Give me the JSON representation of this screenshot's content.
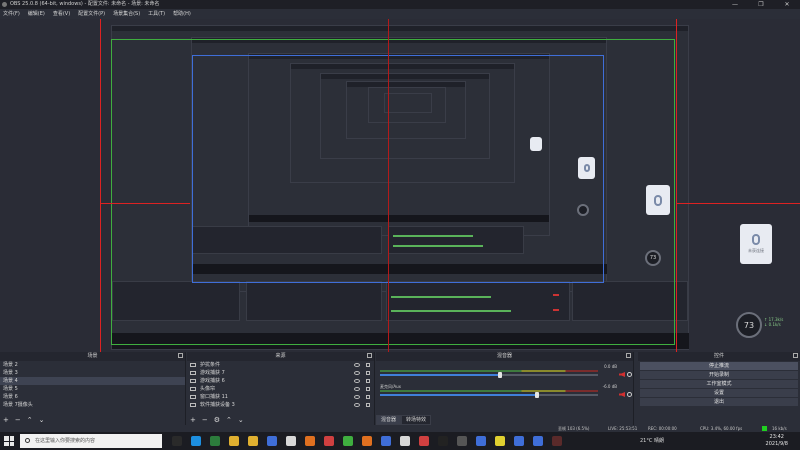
{
  "window": {
    "title": "OBS 25.0.8 (64-bit, windows) - 配置文件: 未命名 - 场景: 未命名",
    "controls": [
      "—",
      "❐",
      "✕"
    ]
  },
  "menu": [
    "文件(F)",
    "编辑(E)",
    "查看(V)",
    "配置文件(P)",
    "场景集合(S)",
    "工具(T)",
    "帮助(H)"
  ],
  "preview": {
    "widget_caption": "未获连接",
    "ring_value": "73",
    "ring_stats": [
      "↑ 17.3k/s",
      "↓ 0.1k/s"
    ],
    "colors": {
      "guide": "#d22222",
      "outer_green": "#3fae3f",
      "inner_blue": "#3f6ed8"
    }
  },
  "docks": {
    "scenes": {
      "title": "场景",
      "items": [
        "场景 2",
        "场景 3",
        "场景 4",
        "场景 5",
        "场景 6",
        "场景 7摄像头"
      ],
      "selected_index": 2
    },
    "sources": {
      "title": "来源",
      "items": [
        "护扰条件",
        "游戏捕获 7",
        "游戏捕获 6",
        "头像帘",
        "窗口捕获 11",
        "软件捕获设备 3"
      ]
    },
    "mixer": {
      "title": "混音器",
      "channels": [
        {
          "name": "",
          "db": "0.0 dB",
          "fader": 0.55
        },
        {
          "name": "麦克风/Aux",
          "db": "-6.0 dB",
          "fader": 0.72
        }
      ],
      "tabs": [
        "混音器",
        "转场特效"
      ]
    },
    "controls": {
      "title": "控件",
      "buttons": [
        "停止推流",
        "开始录制",
        "工作室模式",
        "设置",
        "退出"
      ]
    }
  },
  "statusbar": {
    "dropped": "丢帧 103 (6.5%)",
    "live": "LIVE: 25:53:51",
    "rec": "REC: 00:00:00",
    "cpu": "CPU: 3.4%, 60.00 fps",
    "kbps": "16 kb/s"
  },
  "taskbar": {
    "search_placeholder": "在这里输入你要搜索的内容",
    "weather": "21°C 晴朗",
    "time": "23:42",
    "date": "2021/9/8",
    "apps": [
      "#2a2a2a",
      "#1d8fe0",
      "#2c7c3c",
      "#e0b030",
      "#e0b030",
      "#3f6ed8",
      "#d8d8d8",
      "#e07020",
      "#d04040",
      "#3fae3f",
      "#e07020",
      "#3f6ed8",
      "#d8d8d8",
      "#d04040",
      "#222222",
      "#555555",
      "#3f6ed8",
      "#e0d030",
      "#3f6ed8",
      "#3f6ed8",
      "#5a2a2a"
    ]
  }
}
